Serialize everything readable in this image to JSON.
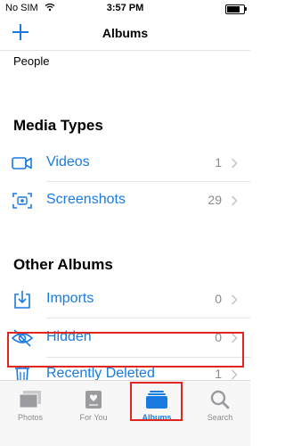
{
  "status_bar": {
    "carrier": "No SIM",
    "time": "3:57 PM"
  },
  "nav": {
    "title": "Albums",
    "add_icon": "plus-icon"
  },
  "people_label": "People",
  "media_types": {
    "title": "Media Types",
    "rows": [
      {
        "label": "Videos",
        "count": "1",
        "icon": "video-camera-icon"
      },
      {
        "label": "Screenshots",
        "count": "29",
        "icon": "screenshot-icon"
      }
    ]
  },
  "other_albums": {
    "title": "Other Albums",
    "rows": [
      {
        "label": "Imports",
        "count": "0",
        "icon": "import-icon"
      },
      {
        "label": "Hidden",
        "count": "0",
        "icon": "eye-slash-icon"
      },
      {
        "label": "Recently Deleted",
        "count": "1",
        "icon": "trash-icon"
      }
    ]
  },
  "tabs": [
    {
      "label": "Photos",
      "icon": "photos-icon"
    },
    {
      "label": "For You",
      "icon": "for-you-icon"
    },
    {
      "label": "Albums",
      "icon": "albums-icon",
      "active": true
    },
    {
      "label": "Search",
      "icon": "search-icon"
    }
  ],
  "colors": {
    "accent": "#1a7ae0",
    "highlight": "#e0261e",
    "gray": "#8a8a8e"
  }
}
